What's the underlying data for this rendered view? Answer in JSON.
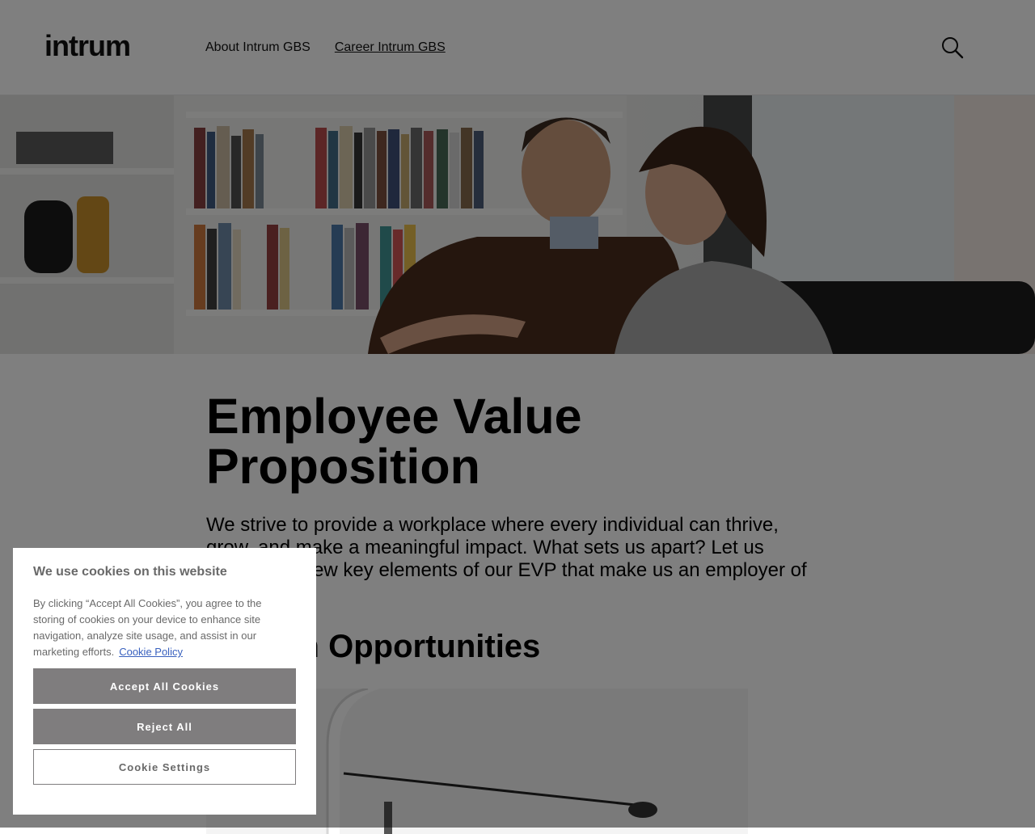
{
  "header": {
    "logo": "intrum",
    "nav": [
      {
        "label": "About Intrum GBS",
        "active": false
      },
      {
        "label": "Career Intrum GBS",
        "active": true
      }
    ],
    "search_icon": "search-icon"
  },
  "main": {
    "title": "Employee Value Proposition",
    "intro": "We strive to provide a workplace where every individual can thrive, grow, and make a meaningful impact. What sets us apart? Let us introduce a few key elements of our EVP that make us an employer of choice.",
    "section_title": "Growth Opportunities"
  },
  "cookie_banner": {
    "title": "We use cookies on this website",
    "description": "By clicking “Accept All Cookies”, you agree to the storing of cookies on your device to enhance site navigation, analyze site usage, and assist in our marketing efforts.",
    "policy_link": "Cookie Policy",
    "accept_label": "Accept All Cookies",
    "reject_label": "Reject All",
    "settings_label": "Cookie Settings"
  },
  "colors": {
    "button_gray": "#7f7d7e",
    "link_blue": "#3860be",
    "text_gray": "#696969",
    "overlay": "rgba(0,0,0,0.5)"
  }
}
